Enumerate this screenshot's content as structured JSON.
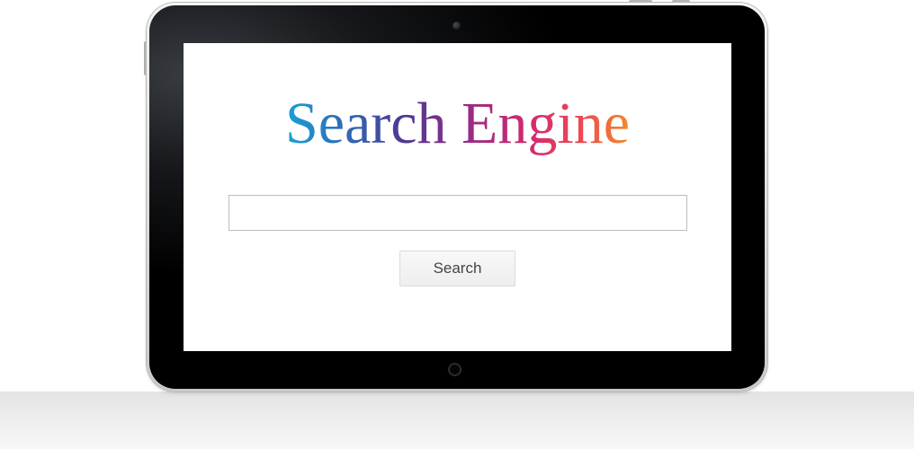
{
  "page": {
    "logo_text": "Search Engine",
    "search": {
      "value": "",
      "placeholder": ""
    },
    "search_button_label": "Search"
  },
  "colors": {
    "logo_gradient": [
      "#1aa0d8",
      "#2d6fb9",
      "#4c3a92",
      "#9c2a86",
      "#d62a6d",
      "#ee4a52",
      "#f28a2a"
    ],
    "bezel": "#000000",
    "screen": "#ffffff",
    "button_background": "#f1f1f1",
    "button_text": "#444444",
    "input_border": "#bdbdbd"
  },
  "icons": {
    "front_camera": "camera-icon",
    "home": "home-button-icon"
  }
}
